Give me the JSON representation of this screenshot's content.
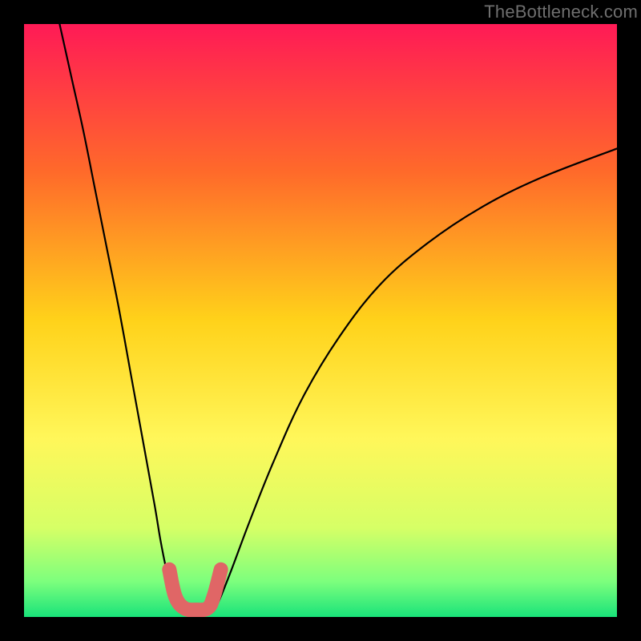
{
  "watermark": "TheBottleneck.com",
  "chart_data": {
    "type": "line",
    "title": "",
    "xlabel": "",
    "ylabel": "",
    "xlim": [
      0,
      100
    ],
    "ylim": [
      0,
      100
    ],
    "grid": false,
    "legend": false,
    "gradient_stops": [
      {
        "offset": 0,
        "color": "#ff1a56"
      },
      {
        "offset": 25,
        "color": "#ff6a2a"
      },
      {
        "offset": 50,
        "color": "#ffd21a"
      },
      {
        "offset": 70,
        "color": "#fff75a"
      },
      {
        "offset": 85,
        "color": "#d6ff66"
      },
      {
        "offset": 94,
        "color": "#7dff7d"
      },
      {
        "offset": 100,
        "color": "#19e37a"
      }
    ],
    "series": [
      {
        "name": "left-branch",
        "color": "#000000",
        "x": [
          6,
          8,
          10,
          12,
          14,
          16,
          18,
          20,
          22,
          23,
          24,
          25,
          26,
          27
        ],
        "y": [
          100,
          91,
          82,
          72,
          62,
          52,
          41,
          30,
          19,
          13,
          8,
          4,
          2,
          1
        ]
      },
      {
        "name": "right-branch",
        "color": "#000000",
        "x": [
          32,
          33,
          35,
          38,
          42,
          47,
          53,
          60,
          68,
          77,
          87,
          100
        ],
        "y": [
          1,
          3,
          8,
          16,
          26,
          37,
          47,
          56,
          63,
          69,
          74,
          79
        ]
      }
    ],
    "highlight": {
      "color": "#e06666",
      "x": [
        24.5,
        25.5,
        27,
        29,
        31,
        32,
        33.2
      ],
      "y": [
        8,
        3.5,
        1.5,
        1.2,
        1.5,
        3.5,
        8
      ]
    }
  }
}
